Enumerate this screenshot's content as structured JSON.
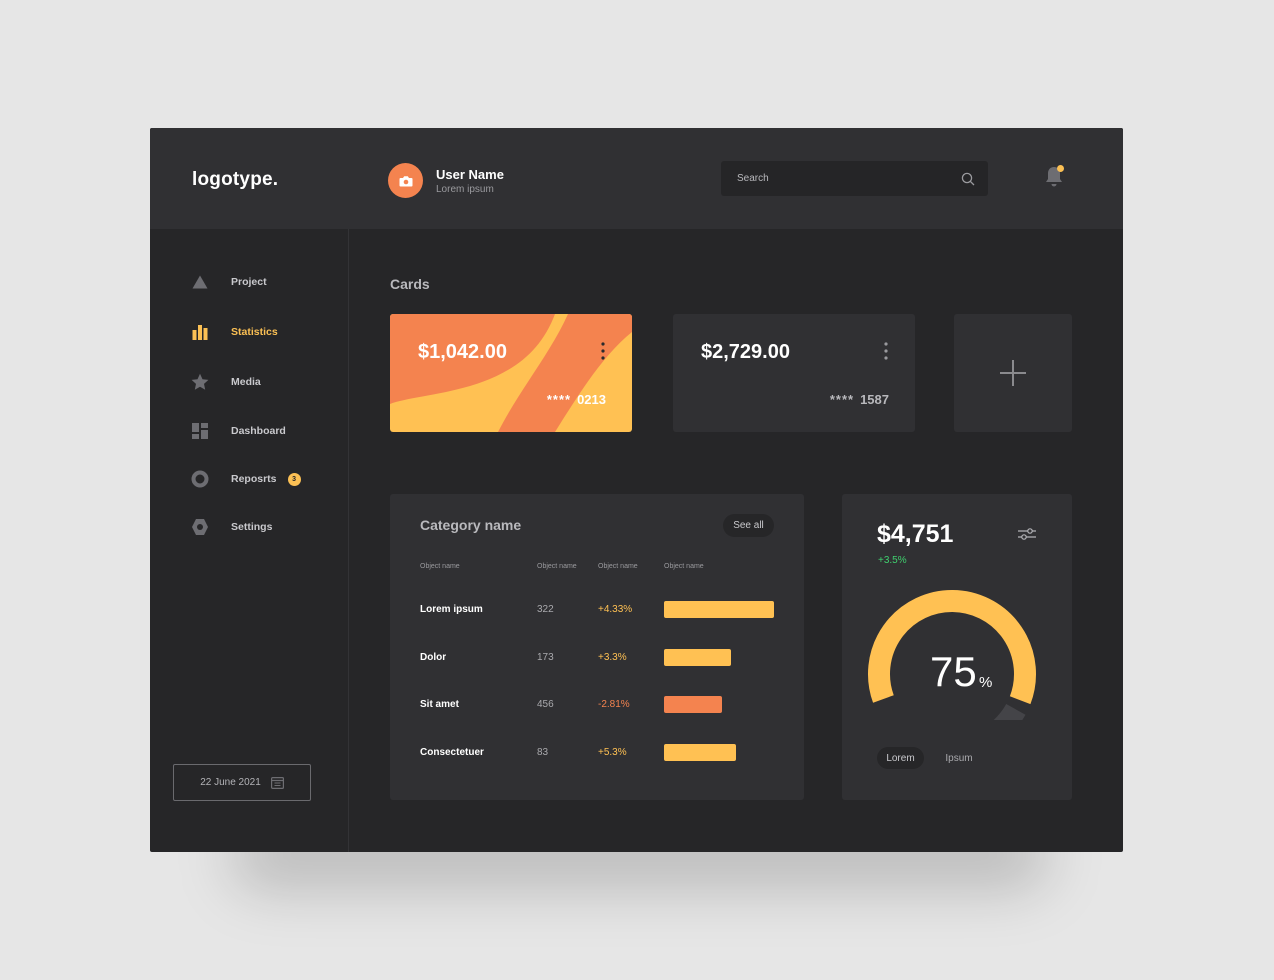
{
  "header": {
    "logo": "logotype.",
    "user_name": "User Name",
    "user_subtitle": "Lorem ipsum",
    "search_placeholder": "Search"
  },
  "sidebar": {
    "items": [
      {
        "label": "Project",
        "icon": "triangle-icon"
      },
      {
        "label": "Statistics",
        "icon": "bar-chart-icon",
        "active": true
      },
      {
        "label": "Media",
        "icon": "star-icon"
      },
      {
        "label": "Dashboard",
        "icon": "dashboard-grid-icon"
      },
      {
        "label": "Reposrts",
        "icon": "circle-icon",
        "badge": "3"
      },
      {
        "label": "Settings",
        "icon": "hexagon-icon"
      }
    ],
    "date": "22 June 2021"
  },
  "cards": {
    "title": "Cards",
    "items": [
      {
        "amount": "$1,042.00",
        "masked": "****",
        "last4": "0213"
      },
      {
        "amount": "$2,729.00",
        "masked": "****",
        "last4": "1587"
      }
    ]
  },
  "table": {
    "title": "Category name",
    "see_all": "See all",
    "headers": [
      "Object name",
      "Object name",
      "Object name",
      "Object name"
    ],
    "rows": [
      {
        "name": "Lorem ipsum",
        "count": "322",
        "change": "+4.33%",
        "level": 1.0,
        "status": "up"
      },
      {
        "name": "Dolor",
        "count": "173",
        "change": "+3.3%",
        "level": 0.61,
        "status": "up"
      },
      {
        "name": "Sit amet",
        "count": "456",
        "change": "-2.81%",
        "level": 0.53,
        "status": "down"
      },
      {
        "name": "Consectetuer",
        "count": "83",
        "change": "+5.3%",
        "level": 0.65,
        "status": "up"
      }
    ]
  },
  "gauge": {
    "amount": "$4,751",
    "change": "+3.5%",
    "value": "75",
    "unit": "%",
    "fraction": 0.75,
    "tabs": [
      "Lorem",
      "Ipsum"
    ]
  },
  "colors": {
    "accent_yellow": "#ffc153",
    "accent_orange": "#f4834f",
    "positive_green": "#3fcf6e",
    "panel": "#303033",
    "background": "#262628"
  }
}
